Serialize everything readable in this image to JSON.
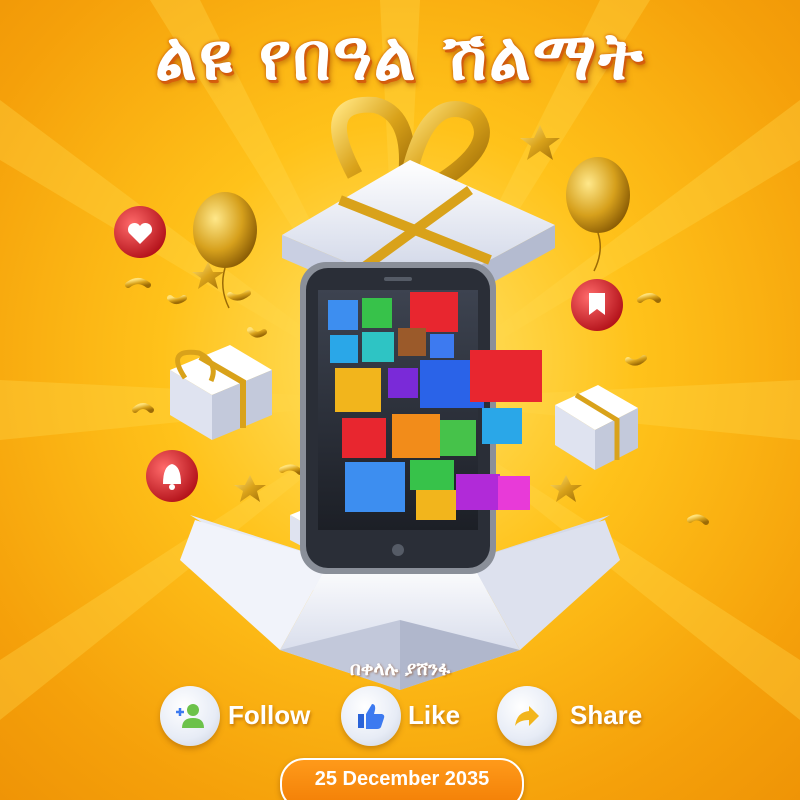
{
  "poster": {
    "title": "ልዩ የበዓል ሽልማት",
    "brand": "በቀላሉ ያሸንፋ",
    "social": {
      "follow": "Follow",
      "like": "Like",
      "share": "Share"
    },
    "date": "25 December 2035"
  },
  "colors": {
    "background": "#ffc21a",
    "accent": "#f27e05",
    "gold": "#d9a21a",
    "gift_box": "#eef1fb",
    "badge_red": "#e8262f"
  },
  "icons": [
    "heart-icon",
    "bookmark-icon",
    "bell-icon",
    "add-user-icon",
    "thumbs-up-icon",
    "share-arrow-icon"
  ]
}
